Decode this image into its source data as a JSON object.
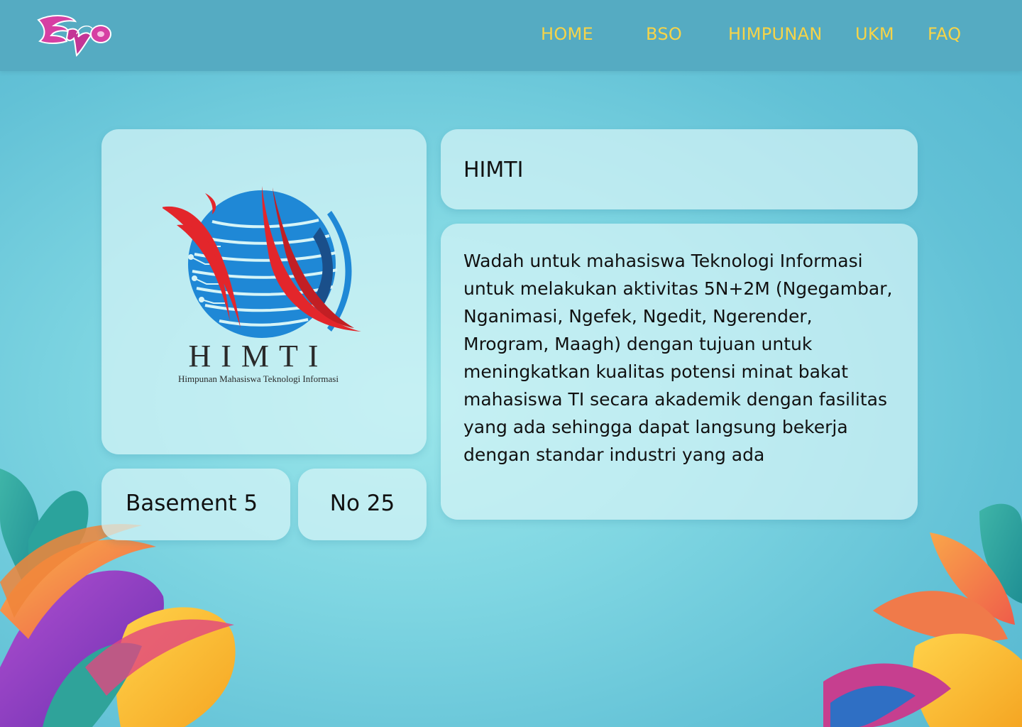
{
  "header": {
    "logo_text": "Expo",
    "nav": {
      "home": "HOME",
      "bso": "BSO",
      "himpunan": "HIMPUNAN",
      "ukm": "UKM",
      "faq": "FAQ"
    },
    "nav_color": "#f7d448",
    "bar_color": "#55abc2"
  },
  "organization": {
    "logo_title": "HIMTI",
    "logo_subtitle": "Himpunan Mahasiswa Teknologi Informasi",
    "name": "HIMTI",
    "location": "Basement 5",
    "booth_number": "No 25",
    "description": "Wadah untuk mahasiswa Teknologi Informasi untuk melakukan aktivitas 5N+2M (Ngegambar, Nganimasi, Ngefek, Ngedit, Ngerender, Mrogram, Maagh) dengan tujuan untuk meningkatkan kualitas potensi minat bakat mahasiswa TI secara akademik dengan fasilitas yang ada sehingga dapat langsung bekerja dengan standar industri yang ada"
  },
  "colors": {
    "logo_blue": "#1f88d6",
    "logo_red": "#e3262b",
    "expo_pink": "#d63fa3"
  }
}
